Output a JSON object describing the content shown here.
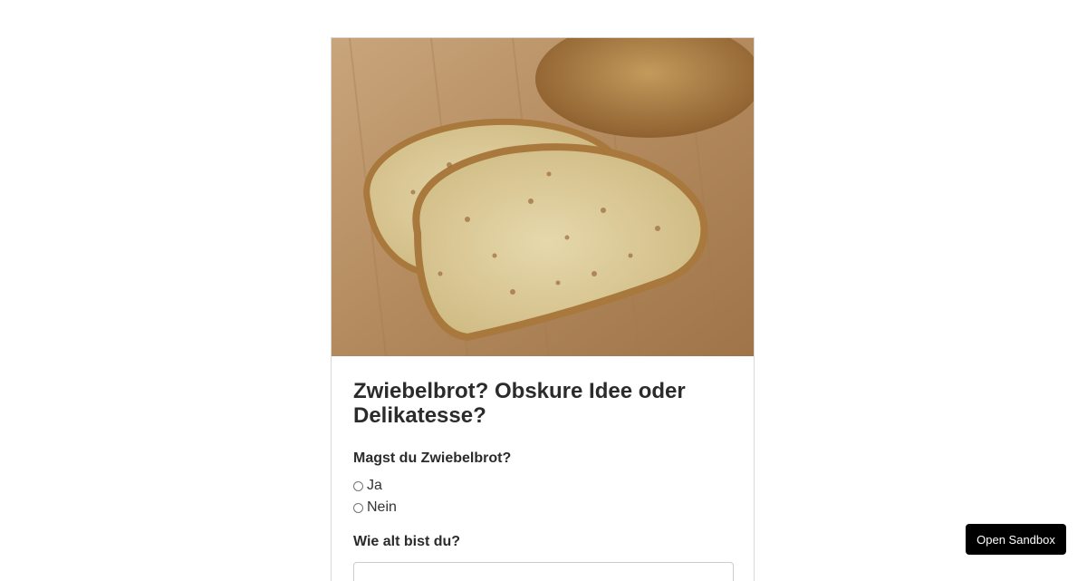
{
  "survey": {
    "title": "Zwiebelbrot? Obskure Idee oder Delikatesse?",
    "question1": {
      "label": "Magst du Zwiebelbrot?",
      "options": [
        "Ja",
        "Nein"
      ]
    },
    "question2": {
      "label": "Wie alt bist du?",
      "value": ""
    }
  },
  "sandbox_button": {
    "label": "Open Sandbox"
  },
  "colors": {
    "board": "#b48a5e",
    "crumb": "#d9c79a",
    "crust": "#a8783c",
    "button_bg": "#000000"
  }
}
